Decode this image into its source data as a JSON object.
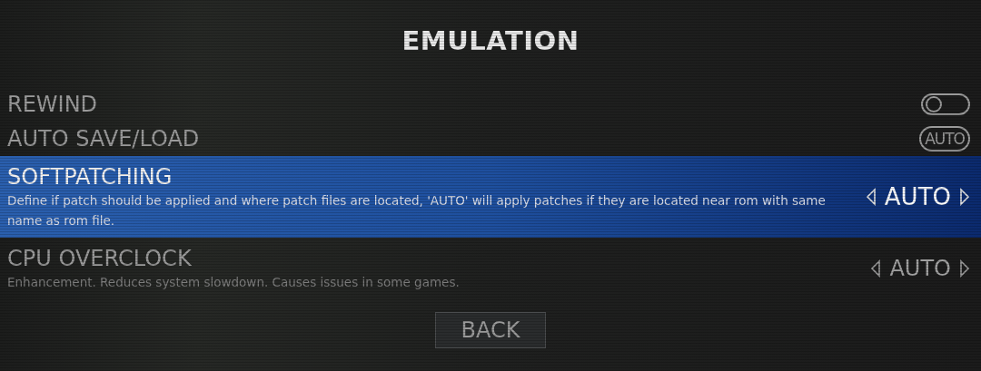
{
  "title": "EMULATION",
  "settings": [
    {
      "kind": "switch",
      "label": "REWIND",
      "on": false,
      "selected": false
    },
    {
      "kind": "badge",
      "label": "AUTO SAVE/LOAD",
      "badge": "AUTO",
      "selected": false
    },
    {
      "kind": "option",
      "label": "SOFTPATCHING",
      "description": "Define if patch should be applied and where patch files are located, 'AUTO' will apply patches if they are located near rom with same name as rom file.",
      "value": "AUTO",
      "selected": true
    },
    {
      "kind": "option",
      "label": "CPU OVERCLOCK",
      "description": "Enhancement. Reduces system slowdown. Causes issues in some games.",
      "value": "AUTO",
      "selected": false
    }
  ],
  "back_button": "BACK"
}
